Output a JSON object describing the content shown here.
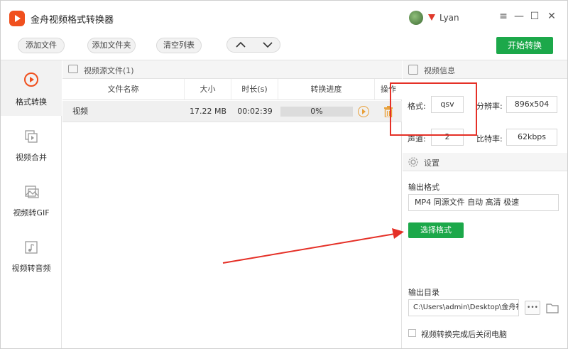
{
  "app": {
    "title": "金舟视频格式转换器",
    "username": "Lyan",
    "window_controls": [
      "≡",
      "—",
      "☐",
      "✕"
    ]
  },
  "toolbar": {
    "add_file": "添加文件",
    "add_folder": "添加文件夹",
    "clear_list": "清空列表",
    "move_up": "︿",
    "move_down": "﹀",
    "start_convert": "开始转换"
  },
  "sidebar": {
    "items": [
      {
        "label": "格式转换",
        "icon": "play-circle-icon",
        "active": true
      },
      {
        "label": "视频合并",
        "icon": "merge-icon",
        "active": false
      },
      {
        "label": "视频转GIF",
        "icon": "gif-image-icon",
        "active": false
      },
      {
        "label": "视频转音频",
        "icon": "music-note-icon",
        "active": false
      }
    ]
  },
  "file_panel": {
    "header": "视频源文件(1)",
    "columns": [
      "文件名称",
      "大小",
      "时长(s)",
      "转换进度",
      "操作"
    ],
    "rows": [
      {
        "name": "视频",
        "size": "17.22 MB",
        "duration": "00:02:39",
        "progress_text": "0%",
        "progress": 0
      }
    ]
  },
  "info_panel": {
    "header": "视频信息",
    "format_label": "格式:",
    "format_value": "qsv",
    "resolution_label": "分辨率:",
    "resolution_value": "896x504",
    "channels_label": "声道:",
    "channels_value": "2",
    "bitrate_label": "比特率:",
    "bitrate_value": "62kbps"
  },
  "settings": {
    "header": "设置",
    "output_format_label": "输出格式",
    "output_format_value": "MP4 同源文件 自动 高清 极速",
    "select_format_button": "选择格式",
    "output_dir_label": "输出目录",
    "output_dir_value": "C:\\Users\\admin\\Desktop\\金舟视",
    "more_button": "•••",
    "shutdown_label": "视频转换完成后关闭电脑",
    "shutdown_checked": false
  },
  "colors": {
    "accent_green": "#1ca84a",
    "annotation_red": "#e53027",
    "logo_orange": "#f0501e"
  }
}
